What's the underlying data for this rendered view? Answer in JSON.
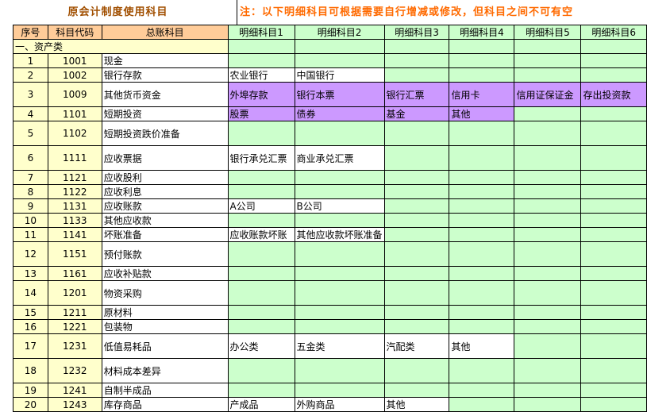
{
  "title": "原会计制度使用科目",
  "note": "注：以下明细科目可根据需要自行增减或修改，但科目之间不可有空",
  "headers": {
    "no": "序号",
    "code": "科目代码",
    "ledger": "总账科目",
    "details": [
      "明细科目1",
      "明细科目2",
      "明细科目3",
      "明细科目4",
      "明细科目5",
      "明细科目6"
    ]
  },
  "category": "一、资产类",
  "colors": {
    "header": "#ffcc99",
    "detail_header": "#ccffcc",
    "index": "#ffffcc",
    "highlight": "#cc99ff",
    "note": "#ff6a00"
  },
  "rows": [
    {
      "no": "1",
      "code": "1001",
      "name": "现金",
      "tall": false,
      "details": [
        "",
        "",
        "",
        "",
        "",
        ""
      ],
      "fills": [
        "g",
        "g",
        "g",
        "g",
        "g",
        "g"
      ]
    },
    {
      "no": "2",
      "code": "1002",
      "name": "银行存款",
      "tall": false,
      "details": [
        "农业银行",
        "中国银行",
        "",
        "",
        "",
        ""
      ],
      "fills": [
        "w",
        "w",
        "g",
        "g",
        "g",
        "g"
      ]
    },
    {
      "no": "3",
      "code": "1009",
      "name": "其他货币资金",
      "tall": true,
      "details": [
        "外埠存款",
        "银行本票",
        "银行汇票",
        "信用卡",
        "信用证保证金",
        "存出投资款"
      ],
      "fills": [
        "p",
        "p",
        "p",
        "p",
        "p",
        "p"
      ]
    },
    {
      "no": "4",
      "code": "1101",
      "name": "短期投资",
      "tall": false,
      "details": [
        "股票",
        "债券",
        "基金",
        "其他",
        "",
        ""
      ],
      "fills": [
        "p",
        "p",
        "p",
        "p",
        "g",
        "g"
      ]
    },
    {
      "no": "5",
      "code": "1102",
      "name": "短期投资跌价准备",
      "tall": true,
      "details": [
        "",
        "",
        "",
        "",
        "",
        ""
      ],
      "fills": [
        "g",
        "g",
        "g",
        "g",
        "g",
        "g"
      ]
    },
    {
      "no": "6",
      "code": "1111",
      "name": "应收票据",
      "tall": true,
      "details": [
        "银行承兑汇票",
        "商业承兑汇票",
        "",
        "",
        "",
        ""
      ],
      "fills": [
        "w",
        "w",
        "g",
        "g",
        "g",
        "g"
      ]
    },
    {
      "no": "7",
      "code": "1121",
      "name": "应收股利",
      "tall": false,
      "details": [
        "",
        "",
        "",
        "",
        "",
        ""
      ],
      "fills": [
        "g",
        "g",
        "g",
        "g",
        "g",
        "g"
      ]
    },
    {
      "no": "8",
      "code": "1122",
      "name": "应收利息",
      "tall": false,
      "details": [
        "",
        "",
        "",
        "",
        "",
        ""
      ],
      "fills": [
        "g",
        "g",
        "g",
        "g",
        "g",
        "g"
      ]
    },
    {
      "no": "9",
      "code": "1131",
      "name": "应收账款",
      "tall": false,
      "details": [
        "A公司",
        "B公司",
        "",
        "",
        "",
        ""
      ],
      "fills": [
        "w",
        "w",
        "g",
        "g",
        "g",
        "g"
      ]
    },
    {
      "no": "10",
      "code": "1133",
      "name": "其他应收款",
      "tall": false,
      "details": [
        "",
        "",
        "",
        "",
        "",
        ""
      ],
      "fills": [
        "g",
        "g",
        "g",
        "g",
        "g",
        "g"
      ]
    },
    {
      "no": "11",
      "code": "1141",
      "name": "坏账准备",
      "tall": false,
      "details": [
        "应收账款坏账",
        "其他应收款坏账准备",
        "",
        "",
        "",
        ""
      ],
      "fills": [
        "w",
        "w",
        "g",
        "g",
        "g",
        "g"
      ]
    },
    {
      "no": "12",
      "code": "1151",
      "name": "预付账款",
      "tall": true,
      "details": [
        "",
        "",
        "",
        "",
        "",
        ""
      ],
      "fills": [
        "g",
        "g",
        "g",
        "g",
        "g",
        "g"
      ]
    },
    {
      "no": "13",
      "code": "1161",
      "name": "应收补贴款",
      "tall": false,
      "details": [
        "",
        "",
        "",
        "",
        "",
        ""
      ],
      "fills": [
        "g",
        "g",
        "g",
        "g",
        "g",
        "g"
      ]
    },
    {
      "no": "14",
      "code": "1201",
      "name": "物资采购",
      "tall": true,
      "details": [
        "",
        "",
        "",
        "",
        "",
        ""
      ],
      "fills": [
        "g",
        "g",
        "g",
        "g",
        "g",
        "g"
      ]
    },
    {
      "no": "15",
      "code": "1211",
      "name": "原材料",
      "tall": false,
      "details": [
        "",
        "",
        "",
        "",
        "",
        ""
      ],
      "fills": [
        "g",
        "g",
        "g",
        "g",
        "g",
        "g"
      ]
    },
    {
      "no": "16",
      "code": "1221",
      "name": "包装物",
      "tall": false,
      "details": [
        "",
        "",
        "",
        "",
        "",
        ""
      ],
      "fills": [
        "g",
        "g",
        "g",
        "g",
        "g",
        "g"
      ]
    },
    {
      "no": "17",
      "code": "1231",
      "name": "低值易耗品",
      "tall": true,
      "details": [
        "办公类",
        "五金类",
        "汽配类",
        "其他",
        "",
        ""
      ],
      "fills": [
        "w",
        "w",
        "w",
        "w",
        "g",
        "g"
      ]
    },
    {
      "no": "18",
      "code": "1232",
      "name": "材料成本差异",
      "tall": true,
      "details": [
        "",
        "",
        "",
        "",
        "",
        ""
      ],
      "fills": [
        "g",
        "g",
        "g",
        "g",
        "g",
        "g"
      ]
    },
    {
      "no": "19",
      "code": "1241",
      "name": "自制半成品",
      "tall": false,
      "details": [
        "",
        "",
        "",
        "",
        "",
        ""
      ],
      "fills": [
        "g",
        "g",
        "g",
        "g",
        "g",
        "g"
      ]
    },
    {
      "no": "20",
      "code": "1243",
      "name": "库存商品",
      "tall": false,
      "details": [
        "产成品",
        "外购商品",
        "其他",
        "",
        "",
        ""
      ],
      "fills": [
        "w",
        "w",
        "w",
        "g",
        "g",
        "g"
      ]
    }
  ]
}
